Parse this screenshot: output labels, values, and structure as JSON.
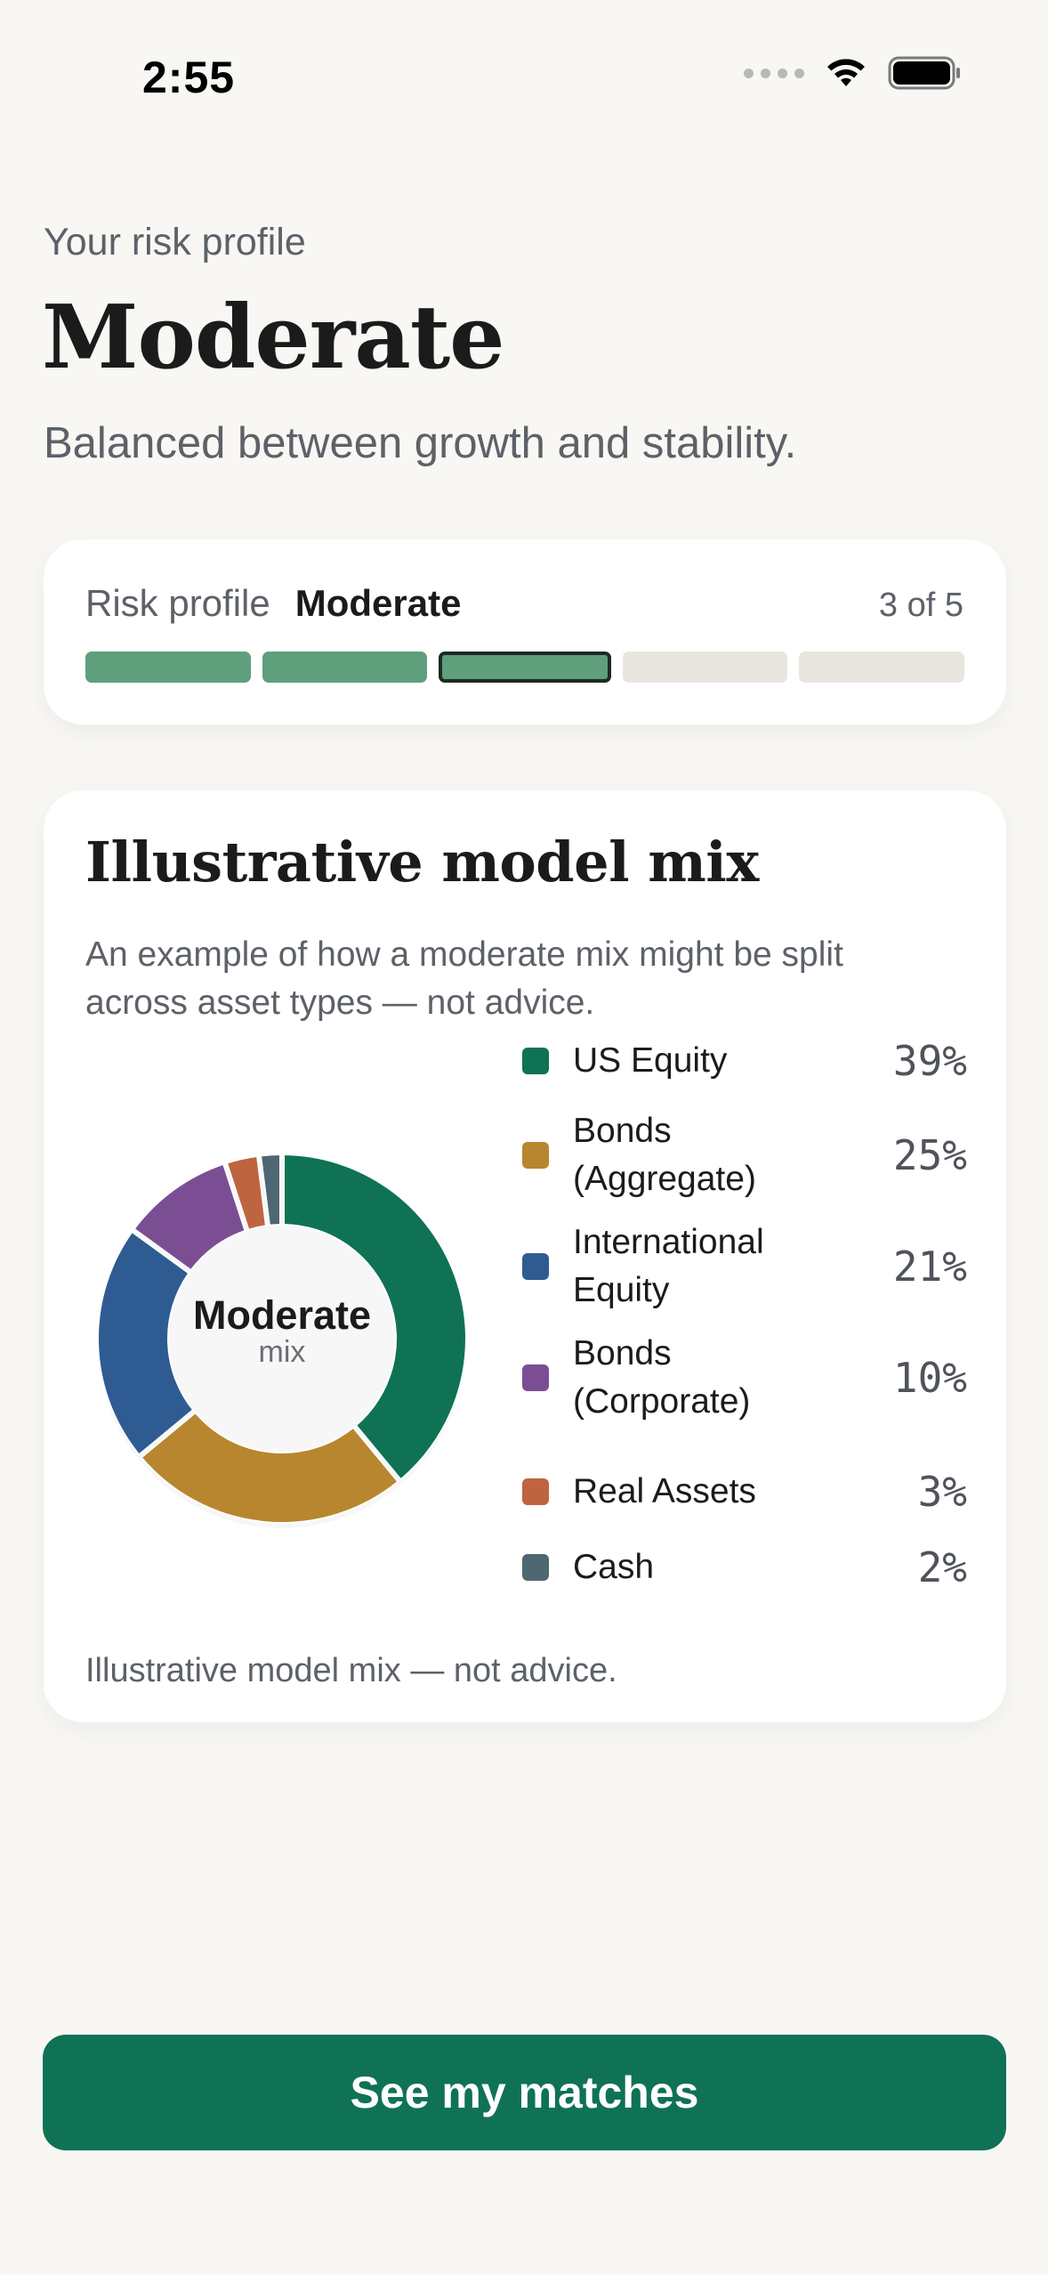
{
  "status_bar": {
    "time": "2:55",
    "icons": [
      "cellular-signal-icon",
      "wifi-icon",
      "battery-icon"
    ]
  },
  "header": {
    "eyebrow": "Your risk profile",
    "title": "Moderate",
    "subtitle": "Balanced between growth and stability."
  },
  "risk_card": {
    "label": "Risk profile",
    "value": "Moderate",
    "count_text": "3 of 5",
    "level": 3,
    "total_levels": 5,
    "colors": {
      "filled": "#5f9f7c",
      "empty": "#e9e6df",
      "active_border": "#1e2a24"
    }
  },
  "mix_card": {
    "title": "Illustrative model mix",
    "description": "An example of how a moderate mix might be split across asset types — not advice.",
    "center_title": "Moderate",
    "center_subtitle": "mix",
    "footnote": "Illustrative model mix — not advice."
  },
  "chart_data": {
    "type": "pie",
    "categories": [
      "US Equity",
      "Bonds (Aggregate)",
      "International Equity",
      "Bonds (Corporate)",
      "Real Assets",
      "Cash"
    ],
    "values": [
      39,
      25,
      21,
      10,
      3,
      2
    ],
    "value_labels": [
      "39%",
      "25%",
      "21%",
      "10%",
      "3%",
      "2%"
    ],
    "colors": [
      "#0f7255",
      "#b8862f",
      "#2f5b93",
      "#7b4e94",
      "#bf6441",
      "#4e6772"
    ]
  },
  "actions": {
    "primary_label": "See my matches"
  },
  "colors": {
    "background": "#f8f7f4",
    "accent": "#0f7255"
  }
}
